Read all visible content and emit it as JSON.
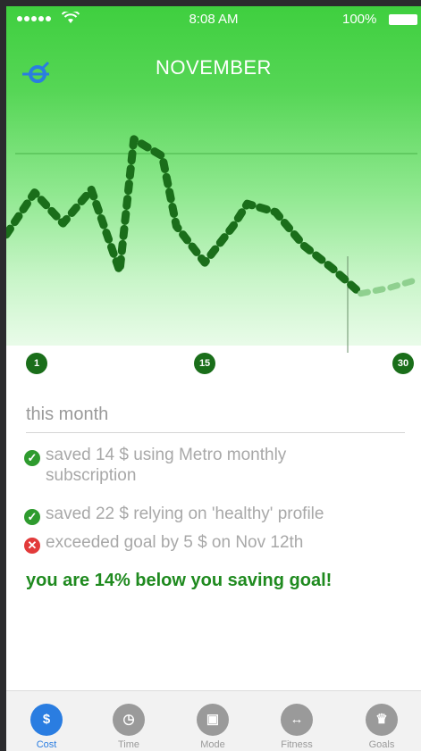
{
  "status_bar": {
    "time": "8:08 AM",
    "battery": "100%"
  },
  "header": {
    "title": "NOVEMBER",
    "menu_icon": "stats-icon"
  },
  "chart_data": {
    "type": "line",
    "x": [
      1,
      3,
      5,
      7,
      9,
      10,
      12,
      13,
      15,
      17,
      18,
      20,
      22,
      24,
      26,
      28,
      30
    ],
    "values": [
      70,
      85,
      74,
      86,
      57,
      104,
      98,
      73,
      60,
      73,
      81,
      78,
      66,
      58,
      49,
      51,
      54
    ],
    "projected_from_index": 14,
    "x_ticks": [
      "1",
      "15",
      "30"
    ],
    "title": "",
    "xlabel": "",
    "ylabel": ""
  },
  "summary": {
    "title": "this month",
    "items": [
      {
        "type": "ok",
        "icon": "check-icon",
        "line1": "saved 14 $ using Metro monthly",
        "line2": "subscription"
      },
      {
        "type": "ok",
        "icon": "check-icon",
        "line1": "saved 22 $ relying on 'healthy' profile",
        "line2": ""
      },
      {
        "type": "bad",
        "icon": "cross-icon",
        "line1": "exceeded goal by 5 $ on Nov 12th",
        "line2": ""
      }
    ],
    "goal_message": "you are 14% below you saving goal!"
  },
  "tabs": [
    {
      "label": "Cost",
      "icon": "dollar-icon",
      "glyph": "$",
      "active": true
    },
    {
      "label": "Time",
      "icon": "clock-icon",
      "glyph": "◷",
      "active": false
    },
    {
      "label": "Mode",
      "icon": "train-icon",
      "glyph": "▣",
      "active": false
    },
    {
      "label": "Fitness",
      "icon": "dumbbell-icon",
      "glyph": "↔",
      "active": false
    },
    {
      "label": "Goals",
      "icon": "trophy-icon",
      "glyph": "♛",
      "active": false
    }
  ],
  "colors": {
    "accent": "#2a7de1",
    "line": "#1a6e1a",
    "ok": "#2e9b2e",
    "bad": "#e23a3a"
  }
}
